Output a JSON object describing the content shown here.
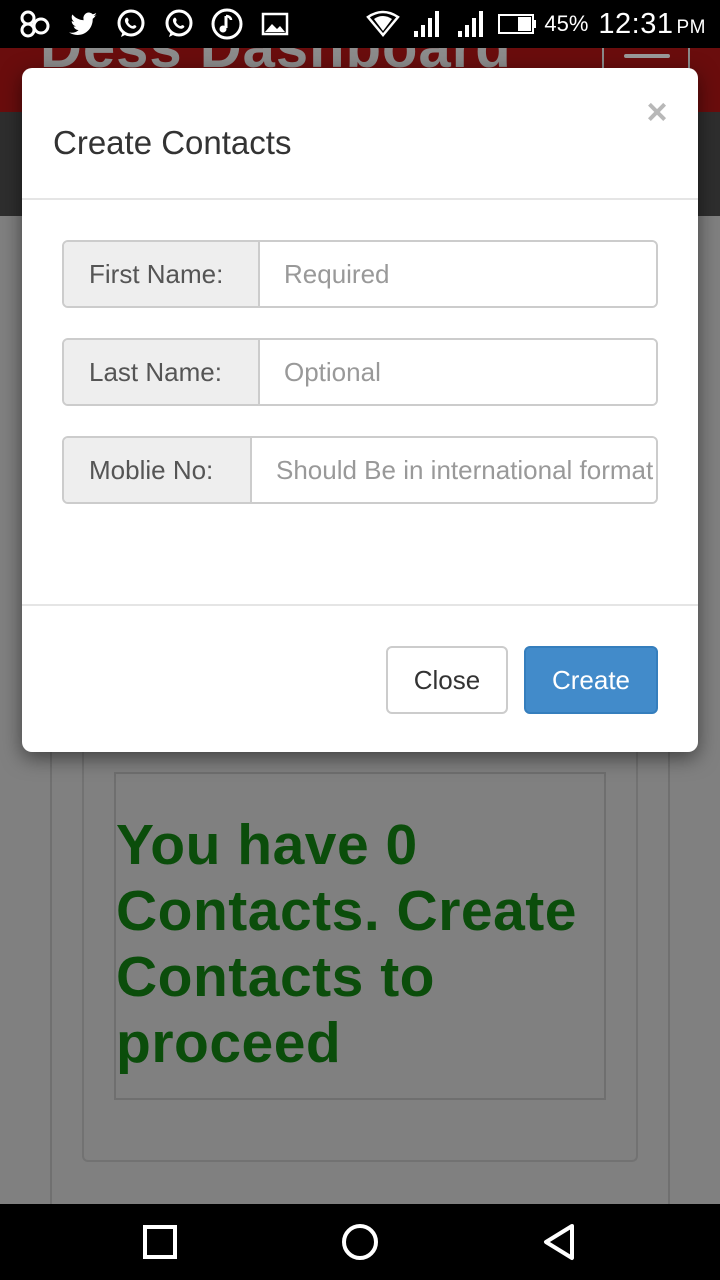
{
  "status_bar": {
    "notification_icons": [
      "app-icon",
      "twitter-icon",
      "whatsapp-icon",
      "whatsapp-icon",
      "music-icon",
      "image-icon"
    ],
    "battery_percent": "45%",
    "time": "12:31",
    "ampm": "PM"
  },
  "background": {
    "header_title": "Dess Dashboard",
    "message": "You have 0 Contacts. Create Contacts to proceed",
    "message_color": "#0b4d0b"
  },
  "modal": {
    "title": "Create Contacts",
    "close_symbol": "×",
    "fields": [
      {
        "label": "First Name:",
        "placeholder": "Required"
      },
      {
        "label": "Last Name:",
        "placeholder": "Optional"
      },
      {
        "label": "Moblie No:",
        "placeholder": "Should Be in international format"
      }
    ],
    "close_button": "Close",
    "create_button": "Create"
  },
  "colors": {
    "primary": "#428bca",
    "overlay": "#808080"
  }
}
